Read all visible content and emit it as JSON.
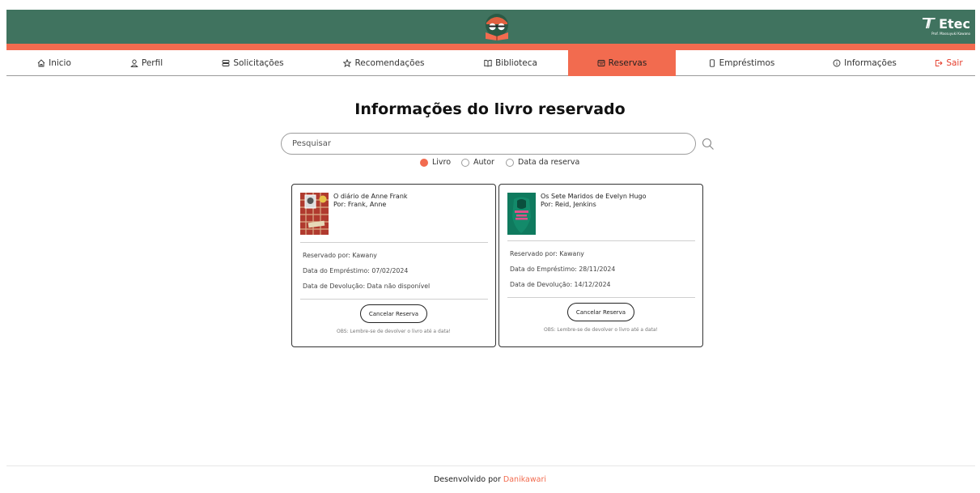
{
  "header": {
    "etec_logo_text": "Etec",
    "etec_logo_subtext": "Prof. Massuyuki Kawano"
  },
  "nav": {
    "items": [
      {
        "label": "Inicio",
        "icon": "home-icon"
      },
      {
        "label": "Perfil",
        "icon": "user-icon"
      },
      {
        "label": "Solicitações",
        "icon": "inbox-icon"
      },
      {
        "label": "Recomendações",
        "icon": "star-icon"
      },
      {
        "label": "Biblioteca",
        "icon": "book-open-icon"
      },
      {
        "label": "Reservas",
        "icon": "reservation-icon",
        "active": true
      },
      {
        "label": "Empréstimos",
        "icon": "phone-icon"
      },
      {
        "label": "Informações",
        "icon": "info-icon"
      },
      {
        "label": "Sair",
        "icon": "logout-icon"
      }
    ]
  },
  "page": {
    "title": "Informações do livro reservado"
  },
  "search": {
    "placeholder": "Pesquisar",
    "value": ""
  },
  "filters": {
    "options": [
      {
        "label": "Livro",
        "checked": true
      },
      {
        "label": "Autor",
        "checked": false
      },
      {
        "label": "Data da reserva",
        "checked": false
      }
    ]
  },
  "reservations": [
    {
      "title": "O diário de Anne Frank",
      "author": "Por: Frank, Anne",
      "reserved_by": "Reservado por: Kawany",
      "loan_date": "Data do Empréstimo: 07/02/2024",
      "return_date": "Data de Devolução: Data não disponível",
      "cancel_label": "Cancelar Reserva",
      "note": "OBS: Lembre-se de devolver o livro até a data!"
    },
    {
      "title": "Os Sete Maridos de Evelyn Hugo",
      "author": "Por: Reid, Jenkins",
      "reserved_by": "Reservado por: Kawany",
      "loan_date": "Data do Empréstimo: 28/11/2024",
      "return_date": "Data de Devolução: 14/12/2024",
      "cancel_label": "Cancelar Reserva",
      "note": "OBS: Lembre-se de devolver o livro até a data!"
    }
  ],
  "footer": {
    "prefix": "Desenvolvido por",
    "author": "Danikawari"
  },
  "colors": {
    "header_green": "#40735f",
    "accent_orange": "#f26b4f",
    "logout_red": "#e53d2c"
  }
}
